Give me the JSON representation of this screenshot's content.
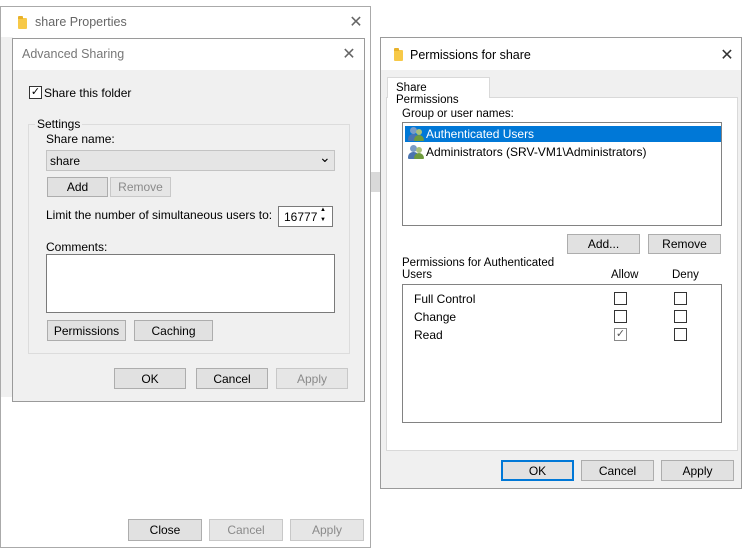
{
  "share_properties": {
    "title": "share Properties",
    "close_label": "Close",
    "cancel_label": "Cancel",
    "apply_label": "Apply"
  },
  "advanced_sharing": {
    "title": "Advanced Sharing",
    "share_this_folder_label": "Share this folder",
    "share_this_folder_checked": true,
    "settings_label": "Settings",
    "share_name_label": "Share name:",
    "share_name_value": "share",
    "add_label": "Add",
    "remove_label": "Remove",
    "limit_label": "Limit the number of simultaneous users to:",
    "limit_value": "16777",
    "comments_label": "Comments:",
    "comments_value": "",
    "permissions_label": "Permissions",
    "caching_label": "Caching",
    "ok_label": "OK",
    "cancel_label": "Cancel",
    "apply_label": "Apply"
  },
  "permissions_dialog": {
    "title": "Permissions for share",
    "tab_label": "Share Permissions",
    "group_label": "Group or user names:",
    "users": [
      {
        "name": "Authenticated Users",
        "selected": true
      },
      {
        "name": "Administrators (SRV-VM1\\Administrators)",
        "selected": false
      }
    ],
    "add_label": "Add...",
    "remove_label": "Remove",
    "permissions_for_line1": "Permissions for Authenticated",
    "permissions_for_line2": "Users",
    "allow_header": "Allow",
    "deny_header": "Deny",
    "permissions": [
      {
        "name": "Full Control",
        "allow": false,
        "deny": false
      },
      {
        "name": "Change",
        "allow": false,
        "deny": false
      },
      {
        "name": "Read",
        "allow": true,
        "deny": false
      }
    ],
    "ok_label": "OK",
    "cancel_label": "Cancel",
    "apply_label": "Apply"
  },
  "icons": {
    "folder": "folder-icon",
    "user_group": "user-group-icon",
    "close": "close-icon",
    "chevron_down": "chevron-down-icon",
    "check": "✓",
    "close_glyph": "✕",
    "chevron_glyph": "⌄",
    "spin_up": "▲",
    "spin_down": "▼"
  },
  "colors": {
    "selection": "#0078d7",
    "dialog_bg": "#f0f0f0",
    "default_button_border": "#0078d7"
  }
}
